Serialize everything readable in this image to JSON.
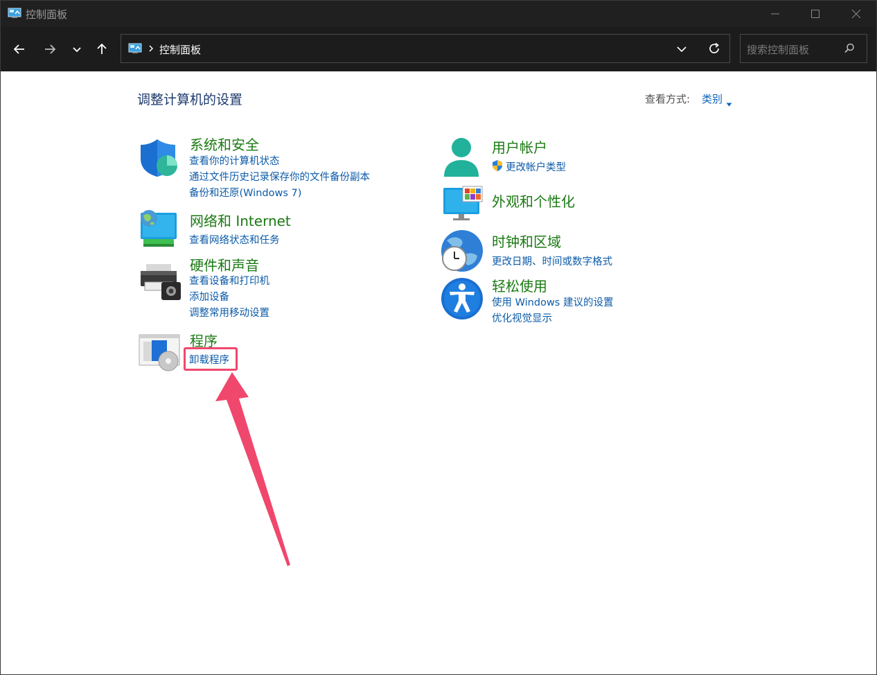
{
  "window": {
    "title": "控制面板"
  },
  "toolbar": {
    "breadcrumb": "控制面板",
    "search_placeholder": "搜索控制面板"
  },
  "content": {
    "heading": "调整计算机的设置",
    "view_by_label": "查看方式:",
    "view_by_value": "类别"
  },
  "left_categories": [
    {
      "title": "系统和安全",
      "icon": "shield-icon",
      "links": [
        "查看你的计算机状态",
        "通过文件历史记录保存你的文件备份副本",
        "备份和还原(Windows 7)"
      ]
    },
    {
      "title": "网络和 Internet",
      "icon": "network-globe-icon",
      "links": [
        "查看网络状态和任务"
      ]
    },
    {
      "title": "硬件和声音",
      "icon": "printer-icon",
      "links": [
        "查看设备和打印机",
        "添加设备",
        "调整常用移动设置"
      ]
    },
    {
      "title": "程序",
      "icon": "programs-icon",
      "links": [
        "卸载程序"
      ]
    }
  ],
  "right_categories": [
    {
      "title": "用户帐户",
      "icon": "user-icon",
      "links": [
        "更改帐户类型"
      ]
    },
    {
      "title": "外观和个性化",
      "icon": "monitor-icon",
      "links": []
    },
    {
      "title": "时钟和区域",
      "icon": "clock-globe-icon",
      "links": [
        "更改日期、时间或数字格式"
      ]
    },
    {
      "title": "轻松使用",
      "icon": "accessibility-icon",
      "links": [
        "使用 Windows 建议的设置",
        "优化视觉显示"
      ]
    }
  ],
  "colors": {
    "titlebar": "#202020",
    "category_title": "#1a7a12",
    "link": "#0c5ba8",
    "highlight": "#f0476d"
  }
}
